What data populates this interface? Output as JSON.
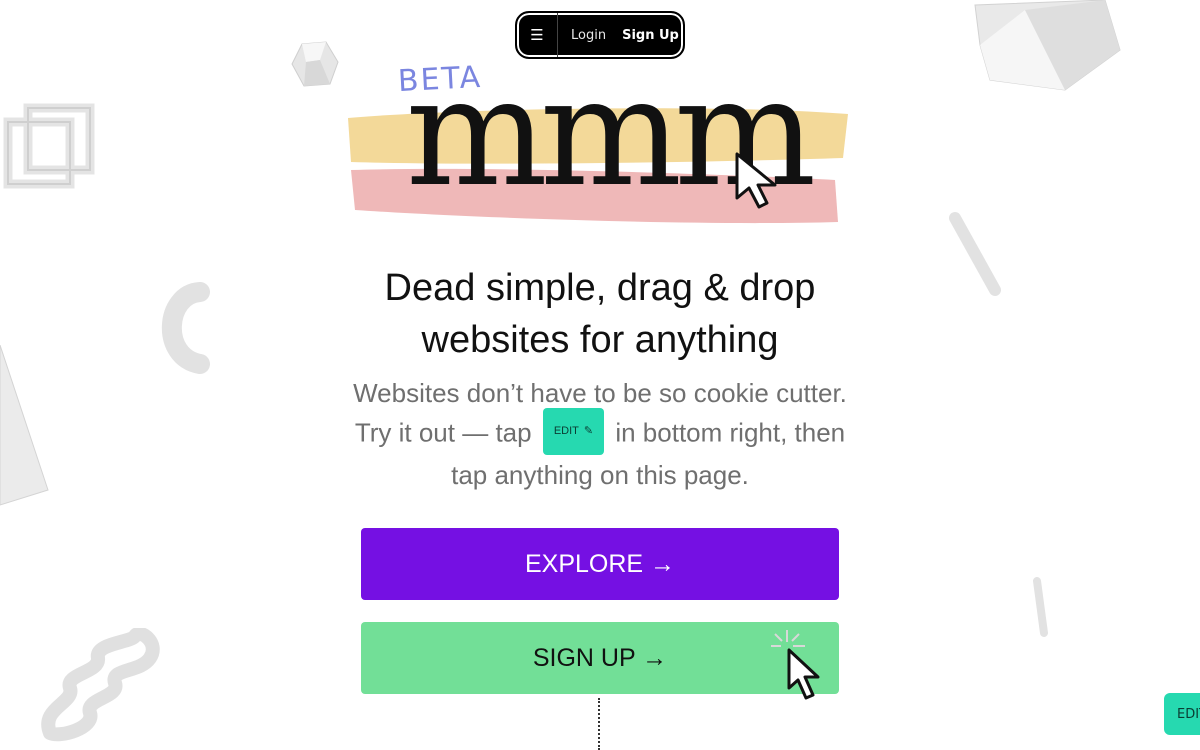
{
  "nav": {
    "menu_icon": "hamburger-icon",
    "login_label": "Login",
    "signup_label": "Sign Up"
  },
  "logo": {
    "beta_label": "BETA",
    "wordmark": "mmm"
  },
  "hero": {
    "headline_line1": "Dead simple, drag & drop",
    "headline_line2": "websites for anything",
    "sub_before": "Websites don’t have to be so cookie cutter. Try it out — tap",
    "sub_chip": "EDIT",
    "sub_after": "in bottom right, then tap anything on this page."
  },
  "cta": {
    "explore_label": "EXPLORE →",
    "signup_label": "SIGN UP →"
  },
  "edit_tab": {
    "label": "EDIT"
  },
  "colors": {
    "explore": "#7510e3",
    "signup": "#72df97",
    "edit": "#26d9b0",
    "beta": "#7b86e0"
  }
}
